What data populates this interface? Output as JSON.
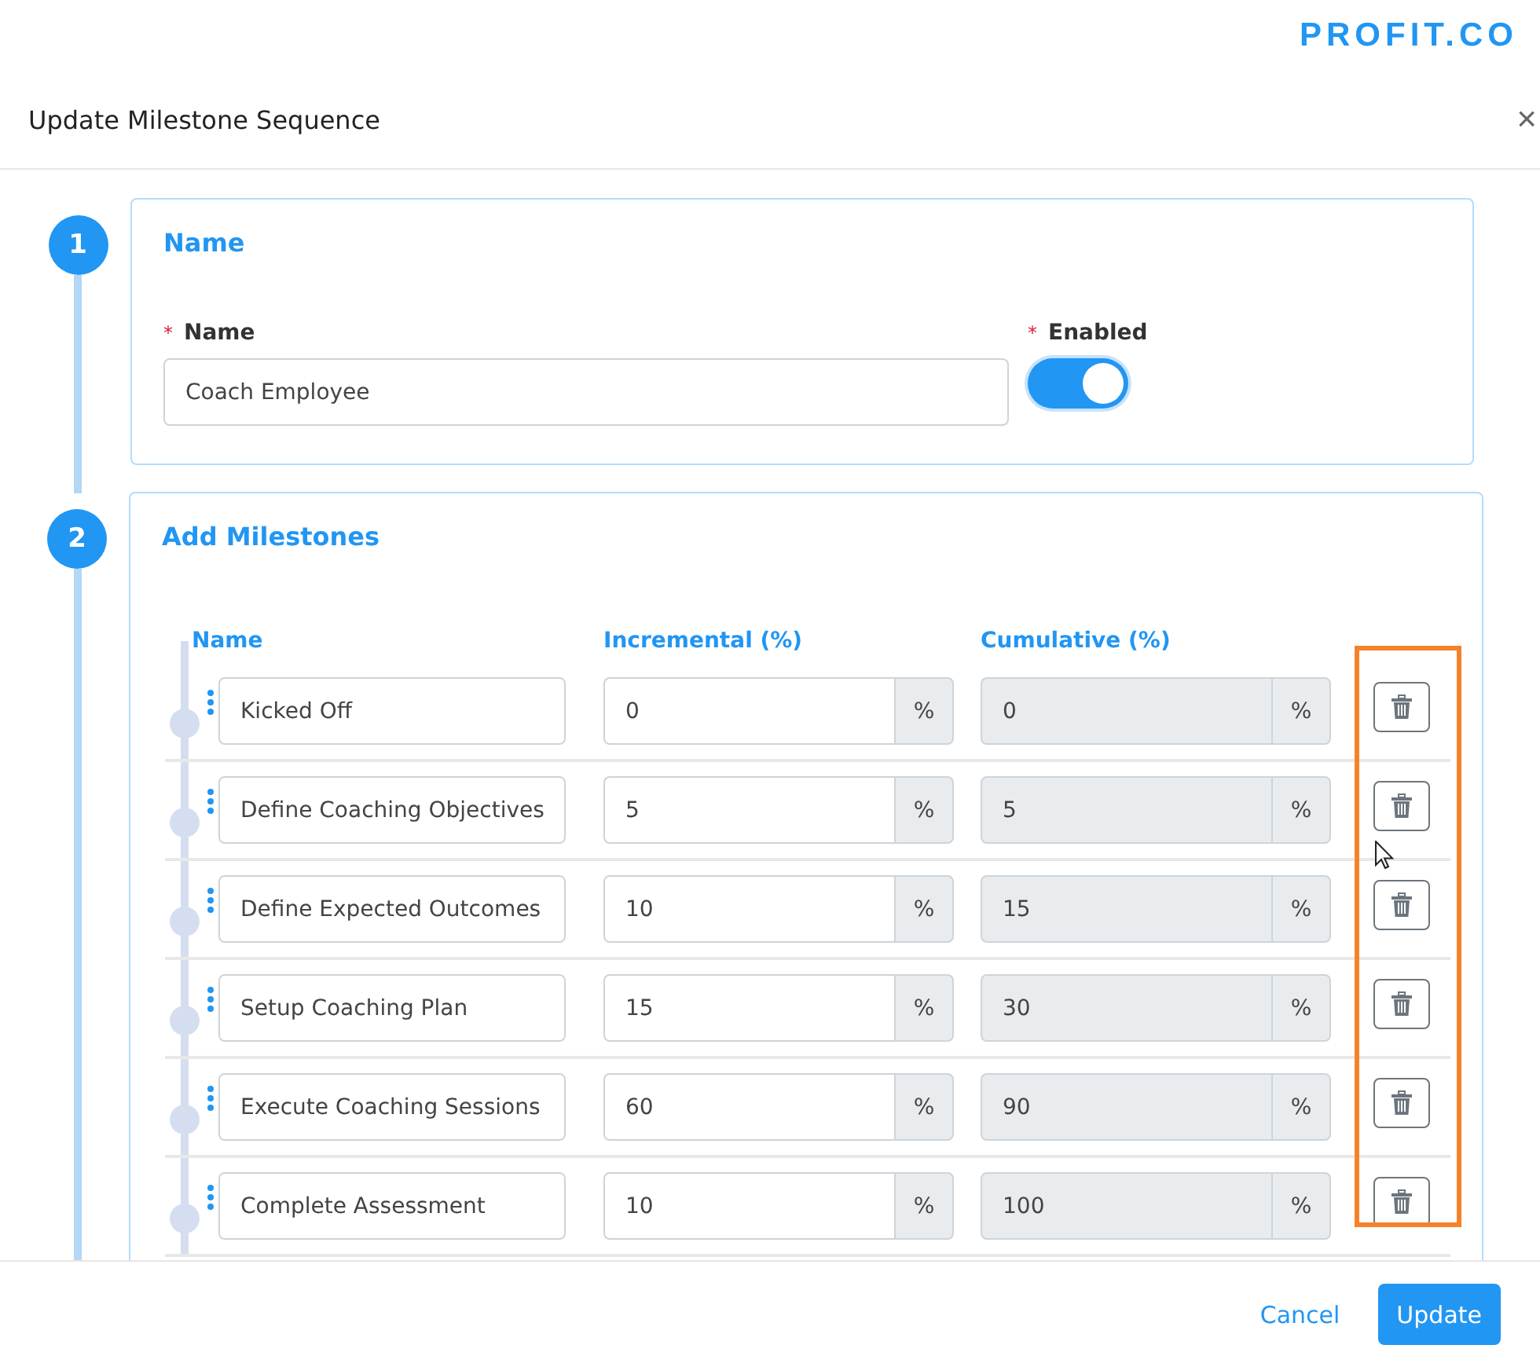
{
  "brand": "PROFIT.CO",
  "dialog": {
    "title": "Update Milestone Sequence",
    "close": "×"
  },
  "steps": [
    {
      "number": "1",
      "title": "Name",
      "kind": "name",
      "name_required": "*",
      "enabled_required": "*",
      "name_label": "Name",
      "name_value": "Coach Employee",
      "enabled_label": "Enabled",
      "enabled": true
    },
    {
      "number": "2",
      "title": "Add Milestones",
      "kind": "milestones",
      "columns": [
        "Name",
        "Incremental (%)",
        "Cumulative (%)"
      ],
      "milestones": [
        {
          "name": "Kicked Off",
          "incremental": "0",
          "incremental_unit": "%",
          "cumulative": "0",
          "cumulative_unit": "%"
        },
        {
          "name": "Define Coaching Objectives",
          "incremental": "5",
          "incremental_unit": "%",
          "cumulative": "5",
          "cumulative_unit": "%"
        },
        {
          "name": "Define Expected Outcomes",
          "incremental": "10",
          "incremental_unit": "%",
          "cumulative": "15",
          "cumulative_unit": "%"
        },
        {
          "name": "Setup Coaching Plan",
          "incremental": "15",
          "incremental_unit": "%",
          "cumulative": "30",
          "cumulative_unit": "%"
        },
        {
          "name": "Execute Coaching Sessions",
          "incremental": "60",
          "incremental_unit": "%",
          "cumulative": "90",
          "cumulative_unit": "%"
        },
        {
          "name": "Complete Assessment",
          "incremental": "10",
          "incremental_unit": "%",
          "cumulative": "100",
          "cumulative_unit": "%"
        }
      ]
    }
  ],
  "buttons": [
    {
      "label": "Cancel",
      "kind": "link"
    },
    {
      "label": "Update",
      "kind": "primary"
    }
  ]
}
